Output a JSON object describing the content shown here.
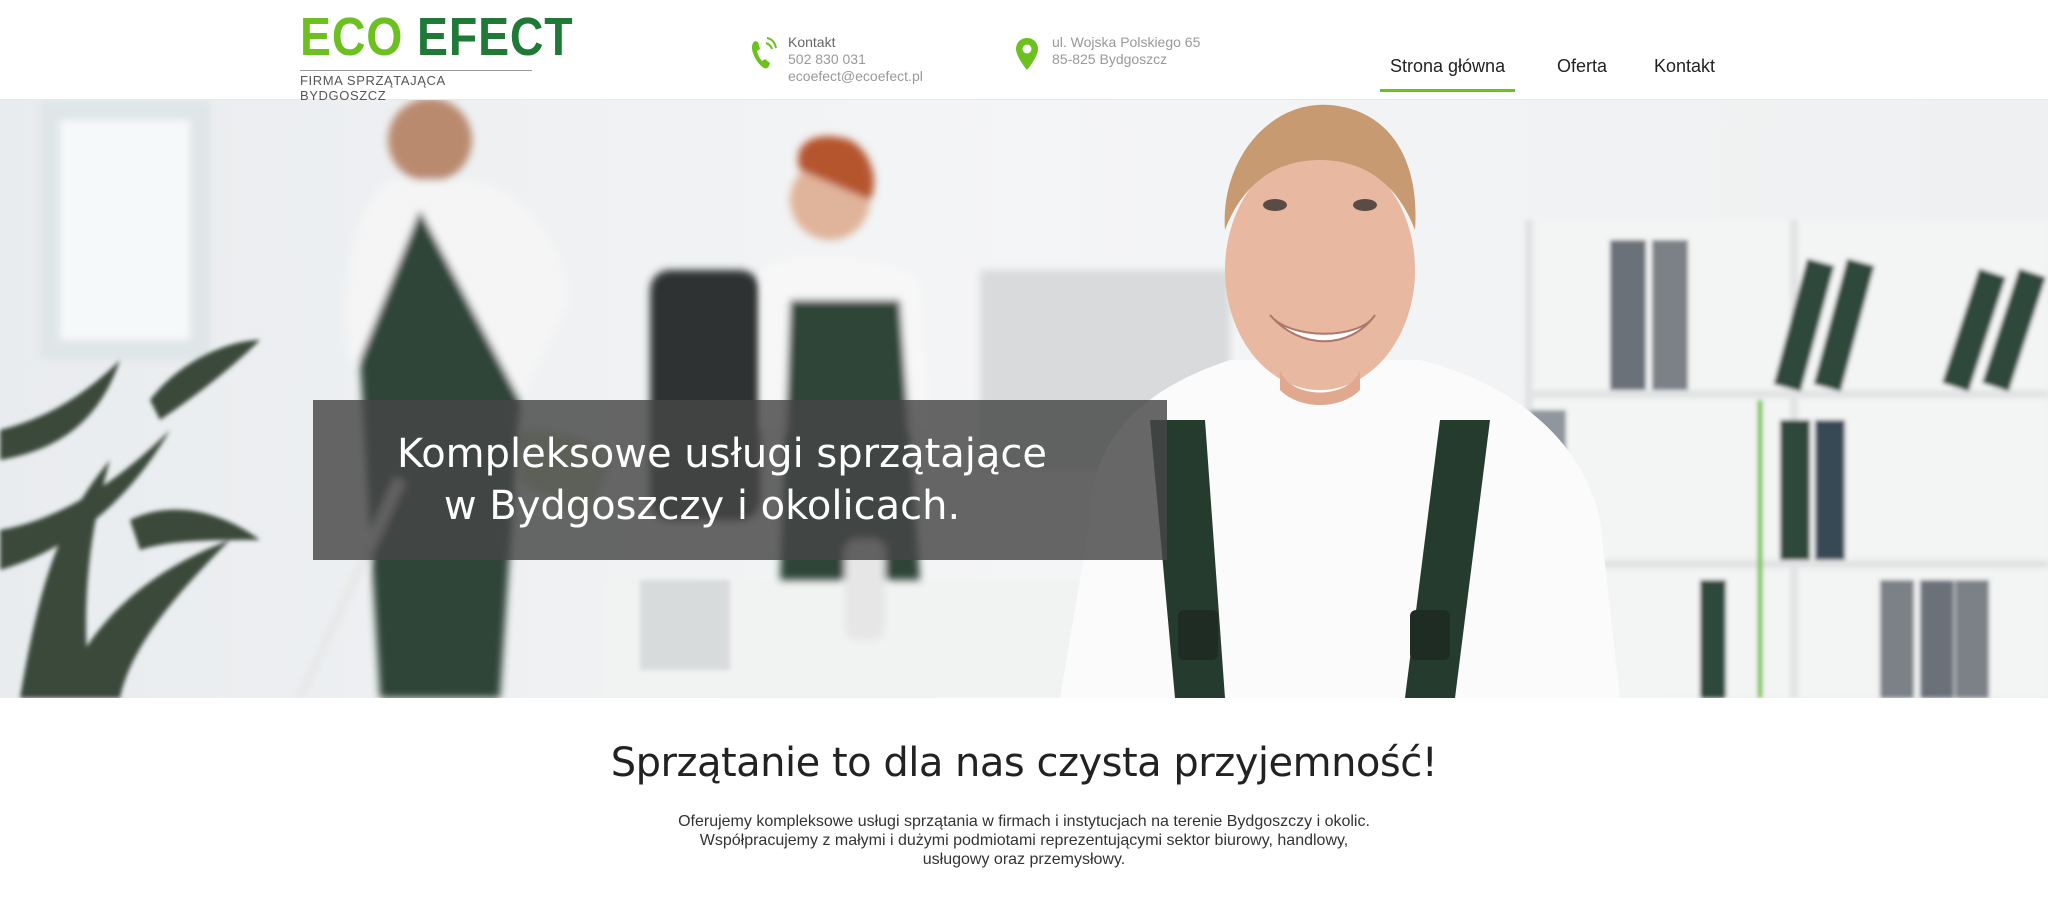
{
  "logo": {
    "word1": "ECO",
    "word2": "EFECT",
    "tagline": "FIRMA SPRZĄTAJĄCA BYDGOSZCZ"
  },
  "contact": {
    "phone_label": "Kontakt",
    "phone": "502 830 031",
    "email": "ecoefect@ecoefect.pl",
    "address_line1": "ul. Wojska Polskiego 65",
    "address_line2": "85-825 Bydgoszcz"
  },
  "nav": {
    "items": [
      {
        "label": "Strona główna"
      },
      {
        "label": "Oferta"
      },
      {
        "label": "Kontakt"
      }
    ]
  },
  "hero": {
    "line1": "Kompleksowe usługi sprzątające",
    "line2": "w Bydgoszczy i okolicach."
  },
  "intro": {
    "title": "Sprzątanie to dla nas czysta przyjemność!",
    "text_line1": "Oferujemy kompleksowe usługi sprzątania w firmach i instytucjach na terenie Bydgoszczy i okolic.",
    "text_line2": "Współpracujemy z małymi i dużymi podmiotami reprezentującymi sektor biurowy, handlowy,",
    "text_line3": "usługowy oraz przemysłowy."
  },
  "colors": {
    "accent_green": "#6cc11f",
    "dark_green": "#1e7a36",
    "caption_bg": "#464646"
  },
  "icons": {
    "phone": "phone-icon",
    "location": "location-pin-icon"
  }
}
